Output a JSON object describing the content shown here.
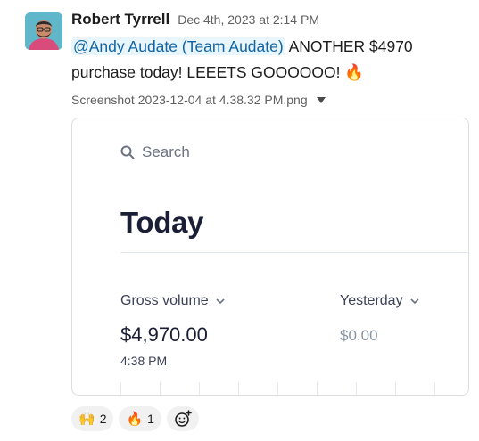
{
  "message": {
    "author": "Robert Tyrrell",
    "timestamp": "Dec 4th, 2023 at 2:14 PM",
    "mention": "@Andy Audate (Team Audate)",
    "text": " ANOTHER $4970 purchase today! LEEETS GOOOOOO! ",
    "text_emoji": "🔥"
  },
  "attachment": {
    "filename": "Screenshot 2023-12-04 at 4.38.32 PM.png"
  },
  "preview": {
    "search_placeholder": "Search",
    "title": "Today",
    "gross_label": "Gross volume",
    "gross_value": "$4,970.00",
    "gross_time": "4:38 PM",
    "yesterday_label": "Yesterday",
    "yesterday_value": "$0.00"
  },
  "reactions": [
    {
      "emoji": "🙌",
      "icon": "raised-hands-icon",
      "count": "2"
    },
    {
      "emoji": "🔥",
      "icon": "fire-icon",
      "count": "1"
    }
  ],
  "colors": {
    "mention_bg": "#e8f5fa",
    "mention_text": "#1264a3",
    "avatar_bg": "#5fb7c9"
  }
}
